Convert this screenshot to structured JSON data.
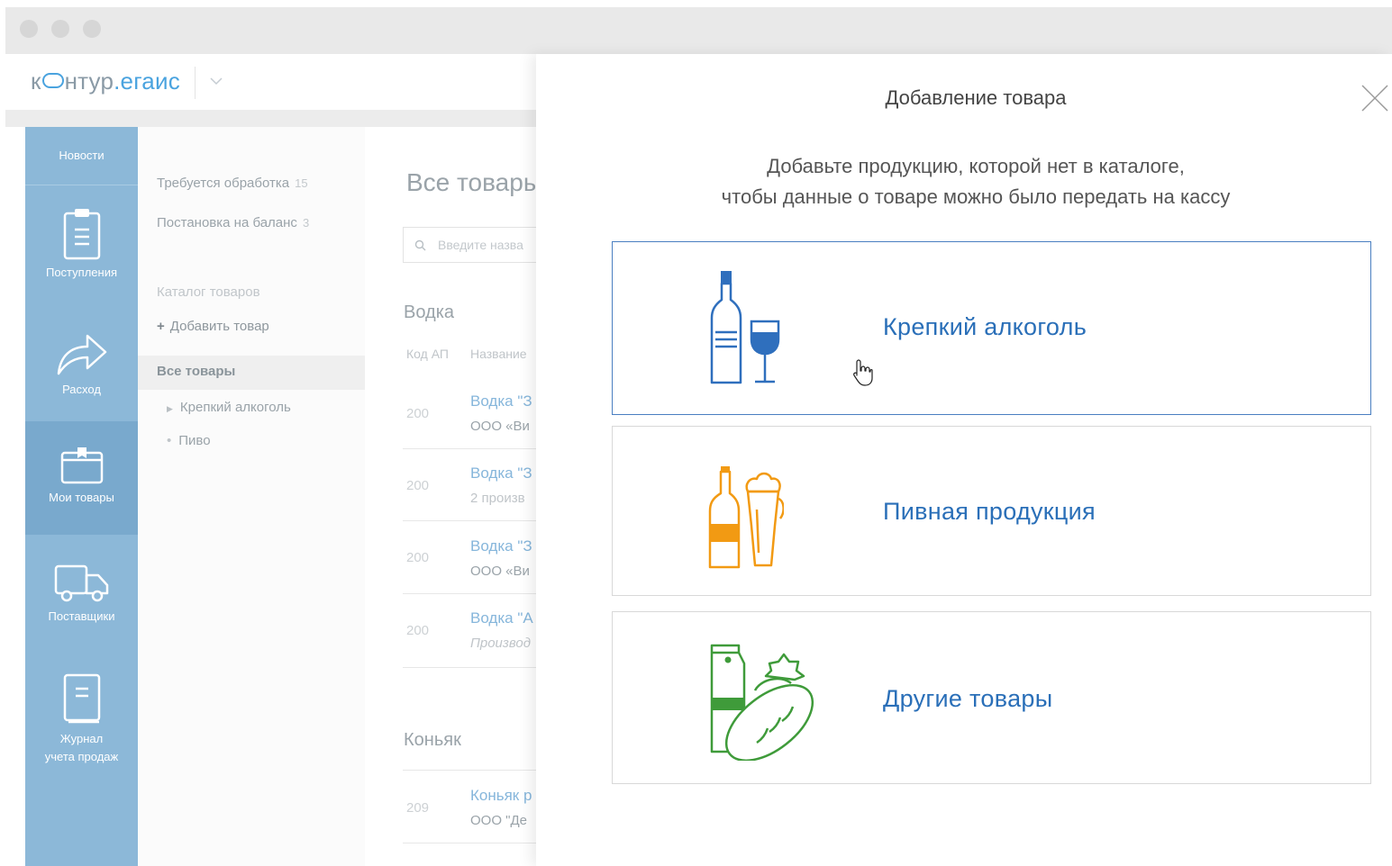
{
  "app": {
    "logo_main": "к",
    "logo_rest": "нтур",
    "logo_accent": ".егаис"
  },
  "nav": {
    "news": "Новости",
    "receipts": "Поступления",
    "expense": "Расход",
    "my_goods": "Мои товары",
    "suppliers": "Поставщики",
    "journal_line1": "Журнал",
    "journal_line2": "учета продаж"
  },
  "sub": {
    "needs_processing": "Требуется обработка",
    "needs_processing_count": "15",
    "balance": "Постановка на баланс",
    "balance_count": "3",
    "catalog": "Каталог товаров",
    "add_item": "Добавить товар",
    "all_items": "Все товары",
    "strong_alcohol": "Крепкий алкоголь",
    "beer": "Пиво"
  },
  "content": {
    "title": "Все товары",
    "search_placeholder": "Введите назва",
    "group_vodka": "Водка",
    "col_code": "Код АП",
    "col_name": "Название",
    "rows": [
      {
        "code": "200",
        "name": "Водка \"З",
        "sub": "ООО «Ви"
      },
      {
        "code": "200",
        "name": "Водка \"З",
        "sub": "2 произв"
      },
      {
        "code": "200",
        "name": "Водка \"З",
        "sub": "ООО «Ви"
      },
      {
        "code": "200",
        "name": "Водка \"А",
        "sub": "Производ"
      }
    ],
    "group_cognac": "Коньяк",
    "cognac_row": {
      "code": "209",
      "name": "Коньяк р",
      "sub": "ООО \"Де"
    }
  },
  "panel": {
    "title": "Добавление товара",
    "subtitle_line1": "Добавьте продукцию, которой нет в каталоге,",
    "subtitle_line2": "чтобы данные о товаре можно было передать на кассу",
    "cards": [
      {
        "label": "Крепкий алкоголь",
        "color": "#2f6fbd"
      },
      {
        "label": "Пивная продукция",
        "color": "#f29a13"
      },
      {
        "label": "Другие товары",
        "color": "#3f9b3a"
      }
    ]
  }
}
